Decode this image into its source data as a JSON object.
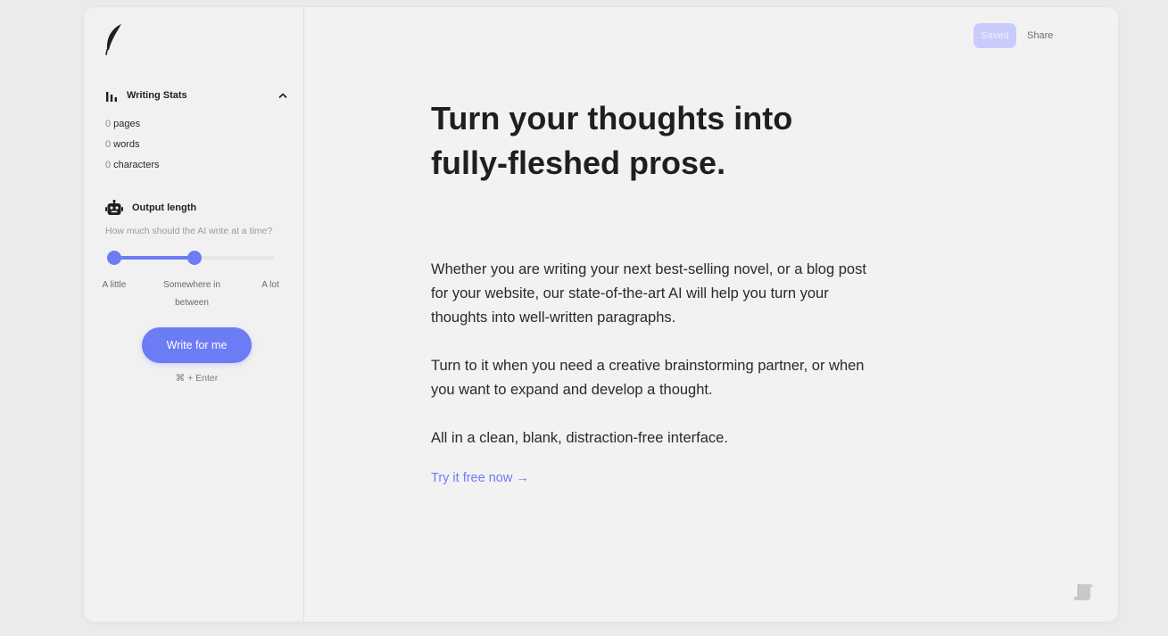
{
  "sidebar": {
    "writing_stats": {
      "title": "Writing Stats",
      "items": [
        {
          "value": "0",
          "label": "pages"
        },
        {
          "value": "0",
          "label": "words"
        },
        {
          "value": "0",
          "label": "characters"
        }
      ]
    },
    "output_length": {
      "title": "Output length",
      "hint": "How much should the AI write at a time?",
      "slider": {
        "value_fraction": 0.5,
        "labels": {
          "min": "A little",
          "mid": "Somewhere in between",
          "max": "A lot"
        }
      }
    },
    "write_button": "Write for me",
    "shortcut": "⌘ + Enter"
  },
  "topbar": {
    "saved": "Saved",
    "share": "Share"
  },
  "content": {
    "headline": "Turn your thoughts into fully-fleshed prose.",
    "paragraphs": [
      "Whether you are writing your next best-selling novel, or a blog post for your website, our state-of-the-art AI will help you turn your thoughts into well-written paragraphs.",
      "Turn to it when you need a creative brainstorming partner, or when you want to expand and develop a thought.",
      "All in a clean, blank, distraction-free interface."
    ],
    "cta": "Try it free now",
    "cta_arrow": "→"
  },
  "colors": {
    "accent": "#6b7cf5",
    "saved_badge": "#c9ccfb",
    "background": "#ebebeb",
    "panel": "#f2f2f3"
  },
  "icons": [
    "feather-logo-icon",
    "bar-chart-icon",
    "chevron-up-icon",
    "robot-icon",
    "scroll-icon"
  ]
}
